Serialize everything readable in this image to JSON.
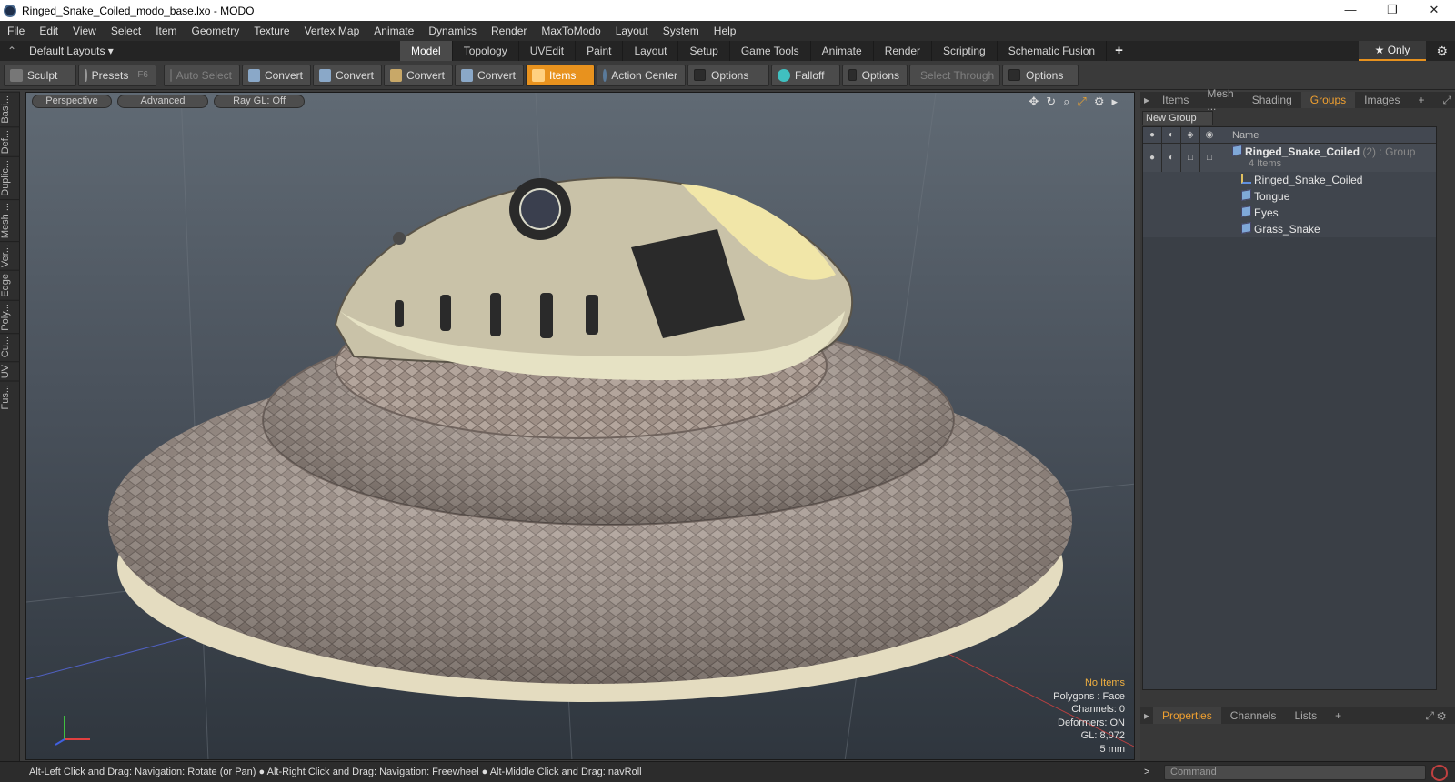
{
  "window": {
    "title": "Ringed_Snake_Coiled_modo_base.lxo - MODO",
    "controls": [
      "—",
      "❐",
      "✕"
    ]
  },
  "menu": [
    "File",
    "Edit",
    "View",
    "Select",
    "Item",
    "Geometry",
    "Texture",
    "Vertex Map",
    "Animate",
    "Dynamics",
    "Render",
    "MaxToModo",
    "Layout",
    "System",
    "Help"
  ],
  "layouts": {
    "label": "Default Layouts ▾",
    "tabs": [
      "Model",
      "Topology",
      "UVEdit",
      "Paint",
      "Layout",
      "Setup",
      "Game Tools",
      "Animate",
      "Render",
      "Scripting",
      "Schematic Fusion"
    ],
    "active": "Model",
    "plus": "+",
    "only": "★  Only",
    "gear": "⚙"
  },
  "toolbar": {
    "sculpt": "Sculpt",
    "presets": "Presets",
    "presets_key": "F6",
    "auto_select": "Auto Select",
    "convert1": "Convert",
    "convert2": "Convert",
    "convert3": "Convert",
    "convert4": "Convert",
    "items": "Items",
    "action_center": "Action Center",
    "options1": "Options",
    "falloff": "Falloff",
    "options2": "Options",
    "select_through": "Select Through",
    "options3": "Options"
  },
  "left_tabs": [
    "Basi...",
    "Def...",
    "Duplic...",
    "Mesh ...",
    "Ver...",
    "Edge",
    "Poly...",
    "Cu...",
    "UV",
    "Fus..."
  ],
  "viewport": {
    "view": "Perspective",
    "shading": "Advanced",
    "raygl": "Ray GL: Off",
    "info": {
      "items": "No Items",
      "polygons": "Polygons : Face",
      "channels": "Channels: 0",
      "deformers": "Deformers: ON",
      "gl": "GL: 8,072",
      "scale": "5 mm"
    }
  },
  "panel": {
    "tabs": [
      "Items",
      "Mesh ...",
      "Shading",
      "Groups",
      "Images"
    ],
    "active": "Groups",
    "plus": "+",
    "new_group": "New Group",
    "col_name": "Name",
    "group": {
      "name": "Ringed_Snake_Coiled",
      "count": "(2)",
      "type": ": Group",
      "subtitle": "4 Items"
    },
    "children": [
      "Ringed_Snake_Coiled",
      "Tongue",
      "Eyes",
      "Grass_Snake"
    ]
  },
  "bottom_tabs": [
    "Properties",
    "Channels",
    "Lists"
  ],
  "status": {
    "hint1": "Alt-Left Click and Drag: Navigation: Rotate (or Pan)",
    "hint2": "Alt-Right Click and Drag: Navigation: Freewheel",
    "hint3": "Alt-Middle Click and Drag: navRoll",
    "command_placeholder": "Command",
    "prompt": ">"
  }
}
